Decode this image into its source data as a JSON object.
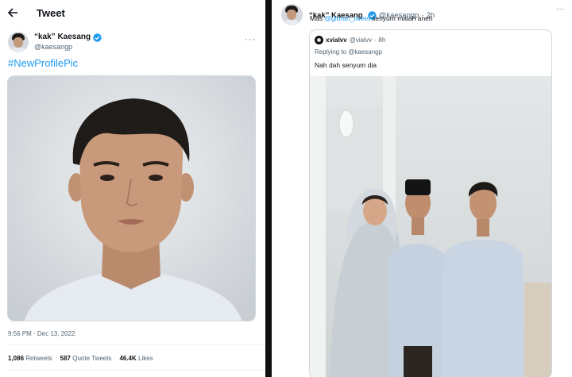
{
  "left_tweet": {
    "header_title": "Tweet",
    "author_name": "“kak” Kaesang",
    "author_handle": "@kaesangp",
    "more_label": "···",
    "hashtag": "#NewProfilePic",
    "timestamp": "9:56 PM · Dec 13, 2022",
    "stats": {
      "retweets_count": "1,086",
      "retweets_label": "Retweets",
      "quotes_count": "587",
      "quotes_label": "Quote Tweets",
      "likes_count": "46.4K",
      "likes_label": "Likes"
    }
  },
  "right_tweet": {
    "author_name": "“kak” Kaesang",
    "author_handle": "@kaesangp",
    "separator": "·",
    "time_ago": "2h",
    "more_label": "···",
    "text_before": "Mas ",
    "mention": "@gibran_tweet",
    "text_after": " senyum malah aneh",
    "quoted": {
      "author_name": "xvialvv",
      "author_handle": "@vialvv",
      "separator": "·",
      "time_ago": "8h",
      "replying_to": "Replying to @kaesangp",
      "text": "Nah dah senyum dia"
    }
  },
  "colors": {
    "accent": "#1d9bf0",
    "secondary_text": "#536471",
    "primary_text": "#0f1419",
    "background_dark": "#101010"
  },
  "icons": {
    "back": "arrow-left-icon",
    "verified": "verified-badge-icon",
    "more": "more-horizontal-icon"
  }
}
